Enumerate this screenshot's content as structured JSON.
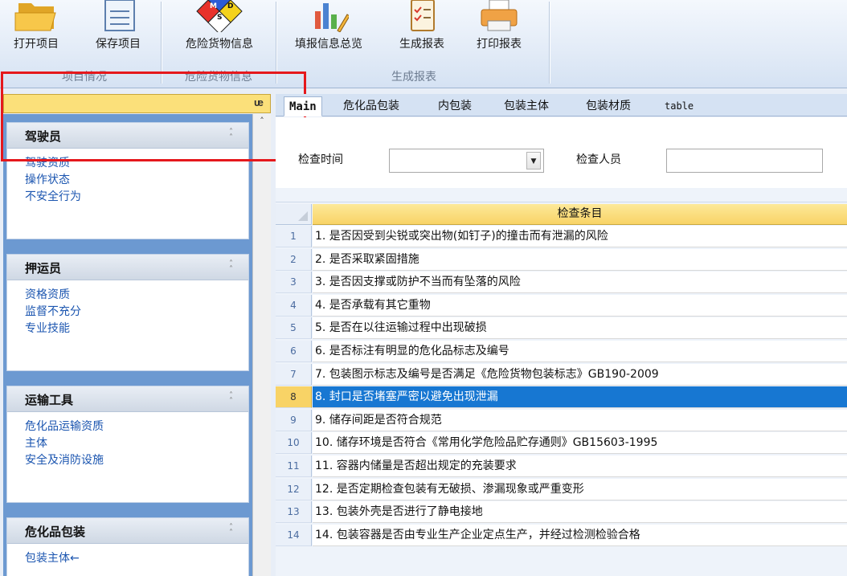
{
  "ribbon": {
    "buttons": [
      {
        "id": "open",
        "label": "打开项目",
        "icon": "folder-icon"
      },
      {
        "id": "save",
        "label": "保存项目",
        "icon": "document-icon"
      },
      {
        "id": "dangerous",
        "label": "危险货物信息",
        "icon": "msds-diamond-icon"
      },
      {
        "id": "overview",
        "label": "填报信息总览",
        "icon": "chart-pencil-icon"
      },
      {
        "id": "generate",
        "label": "生成报表",
        "icon": "checklist-icon"
      },
      {
        "id": "print",
        "label": "打印报表",
        "icon": "printer-icon"
      }
    ],
    "groups": [
      "项目情况",
      "危险货物信息",
      "生成报表"
    ],
    "msds_letters": {
      "m": "M",
      "d": "D",
      "s": "S"
    }
  },
  "left_panel": {
    "pin_glyph": "ᵖ",
    "cards": [
      {
        "title": "驾驶员",
        "items": [
          "驾驶资质",
          "操作状态",
          "不安全行为"
        ]
      },
      {
        "title": "押运员",
        "items": [
          "资格资质",
          "监督不充分",
          "专业技能"
        ]
      },
      {
        "title": "运输工具",
        "items": [
          "危化品运输资质",
          "主体",
          "安全及消防设施"
        ]
      },
      {
        "title": "危化品包装",
        "items": [
          "包装主体←"
        ]
      }
    ]
  },
  "tabs": [
    "Main",
    "危化品包装",
    "内包装",
    "包装主体",
    "包装材质",
    "table"
  ],
  "form": {
    "check_time_label": "检查时间",
    "check_time_value": "",
    "inspector_label": "检查人员",
    "inspector_value": ""
  },
  "grid": {
    "column_header": "检查条目",
    "selected_row": 8,
    "rows": [
      {
        "n": "1",
        "text": "1. 是否因受到尖锐或突出物(如钉子)的撞击而有泄漏的风险"
      },
      {
        "n": "2",
        "text": "2. 是否采取紧固措施"
      },
      {
        "n": "3",
        "text": "3. 是否因支撑或防护不当而有坠落的风险"
      },
      {
        "n": "4",
        "text": "4. 是否承载有其它重物"
      },
      {
        "n": "5",
        "text": "5. 是否在以往运输过程中出现破损"
      },
      {
        "n": "6",
        "text": "6. 是否标注有明显的危化品标志及编号"
      },
      {
        "n": "7",
        "text": "7. 包装图示标志及编号是否满足《危险货物包装标志》GB190-2009"
      },
      {
        "n": "8",
        "text": "8. 封口是否堵塞严密以避免出现泄漏"
      },
      {
        "n": "9",
        "text": "9. 储存间距是否符合规范"
      },
      {
        "n": "10",
        "text": "10. 储存环境是否符合《常用化学危险品贮存通则》GB15603-1995"
      },
      {
        "n": "11",
        "text": "11. 容器内储量是否超出规定的充装要求"
      },
      {
        "n": "12",
        "text": "12. 是否定期检查包装有无破损、渗漏现象或严重变形"
      },
      {
        "n": "13",
        "text": "13. 包装外壳是否进行了静电接地"
      },
      {
        "n": "14",
        "text": "14. 包装容器是否由专业生产企业定点生产，并经过检测检验合格"
      }
    ]
  },
  "colors": {
    "selection": "#1777d2",
    "panel": "#6c99d1",
    "header_yellow": "#f8d366",
    "highlight_frame": "#e5181c"
  }
}
